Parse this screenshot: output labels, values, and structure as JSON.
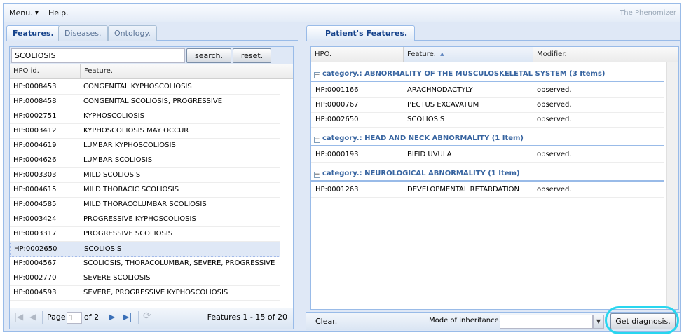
{
  "menubar": {
    "menu_label": "Menu.",
    "help_label": "Help.",
    "brand": "The Phenomizer"
  },
  "left": {
    "tabs": [
      "Features.",
      "Diseases.",
      "Ontology."
    ],
    "search": {
      "value": "SCOLIOSIS",
      "search_label": "search.",
      "reset_label": "reset."
    },
    "columns": [
      "HPO id.",
      "Feature."
    ],
    "rows": [
      {
        "id": "HP:0008453",
        "feature": "CONGENITAL KYPHOSCOLIOSIS"
      },
      {
        "id": "HP:0008458",
        "feature": "CONGENITAL SCOLIOSIS, PROGRESSIVE"
      },
      {
        "id": "HP:0002751",
        "feature": "KYPHOSCOLIOSIS"
      },
      {
        "id": "HP:0003412",
        "feature": "KYPHOSCOLIOSIS MAY OCCUR"
      },
      {
        "id": "HP:0004619",
        "feature": "LUMBAR KYPHOSCOLIOSIS"
      },
      {
        "id": "HP:0004626",
        "feature": "LUMBAR SCOLIOSIS"
      },
      {
        "id": "HP:0003303",
        "feature": "MILD SCOLIOSIS"
      },
      {
        "id": "HP:0004615",
        "feature": "MILD THORACIC SCOLIOSIS"
      },
      {
        "id": "HP:0004585",
        "feature": "MILD THORACOLUMBAR SCOLIOSIS"
      },
      {
        "id": "HP:0003424",
        "feature": "PROGRESSIVE KYPHOSCOLIOSIS"
      },
      {
        "id": "HP:0003317",
        "feature": "PROGRESSIVE SCOLIOSIS"
      },
      {
        "id": "HP:0002650",
        "feature": "SCOLIOSIS"
      },
      {
        "id": "HP:0004567",
        "feature": "SCOLIOSIS, THORACOLUMBAR, SEVERE, PROGRESSIVE"
      },
      {
        "id": "HP:0002770",
        "feature": "SEVERE SCOLIOSIS"
      },
      {
        "id": "HP:0004593",
        "feature": "SEVERE, PROGRESSIVE KYPHOSCOLIOSIS"
      }
    ],
    "selected_index": 11,
    "pager": {
      "page_label": "Page",
      "page_value": "1",
      "of_label": "of 2",
      "summary": "Features 1 - 15 of 20"
    }
  },
  "right": {
    "tab": "Patient's Features.",
    "columns": [
      "HPO.",
      "Feature.",
      "Modifier."
    ],
    "sort_indicator": "▲",
    "groups": [
      {
        "title": "category.: ABNORMALITY OF THE MUSCULOSKELETAL SYSTEM (3 Items)",
        "rows": [
          {
            "hpo": "HP:0001166",
            "feature": "ARACHNODACTYLY",
            "modifier": "observed."
          },
          {
            "hpo": "HP:0000767",
            "feature": "PECTUS EXCAVATUM",
            "modifier": "observed."
          },
          {
            "hpo": "HP:0002650",
            "feature": "SCOLIOSIS",
            "modifier": "observed."
          }
        ]
      },
      {
        "title": "category.: HEAD AND NECK ABNORMALITY (1 Item)",
        "rows": [
          {
            "hpo": "HP:0000193",
            "feature": "BIFID UVULA",
            "modifier": "observed."
          }
        ]
      },
      {
        "title": "category.: NEUROLOGICAL ABNORMALITY (1 Item)",
        "rows": [
          {
            "hpo": "HP:0001263",
            "feature": "DEVELOPMENTAL RETARDATION",
            "modifier": "observed."
          }
        ]
      }
    ],
    "toolbar": {
      "clear_label": "Clear.",
      "mode_label": "Mode of inheritance.",
      "mode_value": "",
      "diagnose_label": "Get diagnosis."
    }
  },
  "colors": {
    "accent": "#15428b",
    "group_title": "#3764a0",
    "highlight_ring": "#28d6ef"
  }
}
